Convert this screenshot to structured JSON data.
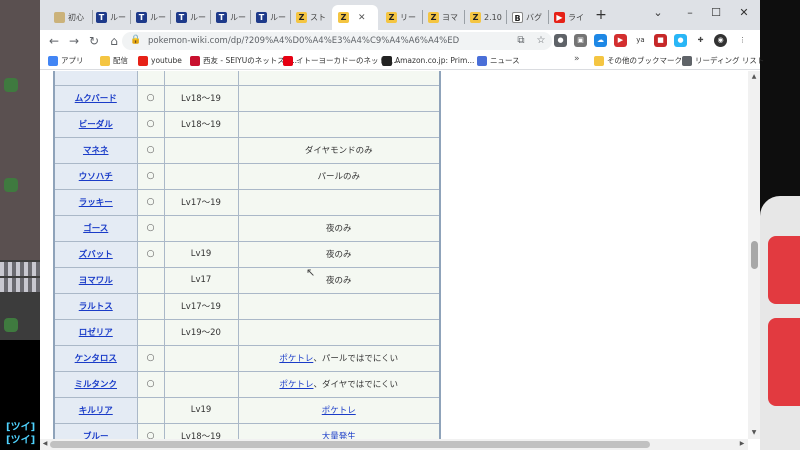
{
  "tabs": [
    {
      "icon": "folder-favicon",
      "title": "初心"
    },
    {
      "icon": "t-favicon",
      "title": "ルー"
    },
    {
      "icon": "t-favicon",
      "title": "ルー"
    },
    {
      "icon": "t-favicon",
      "title": "ルー"
    },
    {
      "icon": "t-favicon",
      "title": "ルー"
    },
    {
      "icon": "t-favicon",
      "title": "ルー"
    },
    {
      "icon": "z-favicon",
      "title": "スト"
    },
    {
      "icon": "z-favicon",
      "title": "",
      "active": true
    },
    {
      "icon": "z-favicon",
      "title": "リー"
    },
    {
      "icon": "z-favicon",
      "title": "ヨマ"
    },
    {
      "icon": "z-favicon",
      "title": "2.10"
    },
    {
      "icon": "b-favicon",
      "title": "バグ"
    },
    {
      "icon": "youtube-favicon",
      "title": "ライ"
    }
  ],
  "toolbar": {
    "url": "pokemon-wiki.com/dp/?209%A4%D0%A4%E3%A4%C9%A4%A6%A4%ED"
  },
  "bookmarks": [
    {
      "label": "アプリ",
      "color": "#4285f4"
    },
    {
      "label": "配信",
      "color": "#f4c542"
    },
    {
      "label": "youtube",
      "color": "#e62117"
    },
    {
      "label": "西友 - SEIYUのネットスー...",
      "color": "#c8102e"
    },
    {
      "label": "イトーヨーカドーのネットス...",
      "color": "#e60012"
    },
    {
      "label": "Amazon.co.jp: Prim...",
      "color": "#222222"
    },
    {
      "label": "ニュース",
      "color": "#4a6fd8"
    }
  ],
  "bookmarks_right": [
    {
      "label": "その他のブックマーク",
      "color": "#f4c542"
    },
    {
      "label": "リーディング リスト",
      "color": "#5f6368"
    }
  ],
  "table": {
    "rows": [
      {
        "name": "ムクバード",
        "mark": "○",
        "lv": "Lv18～19",
        "note": ""
      },
      {
        "name": "ビーダル",
        "mark": "○",
        "lv": "Lv18～19",
        "note": ""
      },
      {
        "name": "マネネ",
        "mark": "○",
        "lv": "",
        "note": "ダイヤモンドのみ"
      },
      {
        "name": "ウソハチ",
        "mark": "○",
        "lv": "",
        "note": "パールのみ"
      },
      {
        "name": "ラッキー",
        "mark": "○",
        "lv": "Lv17～19",
        "note": ""
      },
      {
        "name": "ゴース",
        "mark": "○",
        "lv": "",
        "note": "夜のみ"
      },
      {
        "name": "ズバット",
        "mark": "○",
        "lv": "Lv19",
        "note": "夜のみ"
      },
      {
        "name": "ヨマワル",
        "mark": "",
        "lv": "Lv17",
        "note": "夜のみ"
      },
      {
        "name": "ラルトス",
        "mark": "",
        "lv": "Lv17～19",
        "note": ""
      },
      {
        "name": "ロゼリア",
        "mark": "",
        "lv": "Lv19～20",
        "note": ""
      },
      {
        "name": "ケンタロス",
        "mark": "○",
        "lv": "",
        "note_link": "ポケトレ",
        "note": "、パールではでにくい"
      },
      {
        "name": "ミルタンク",
        "mark": "○",
        "lv": "",
        "note_link": "ポケトレ",
        "note": "、ダイヤではでにくい"
      },
      {
        "name": "キルリア",
        "mark": "",
        "lv": "Lv19",
        "note_link": "ポケトレ",
        "note": ""
      },
      {
        "name": "ブルー",
        "mark": "○",
        "lv": "Lv18～19",
        "note_link": "大量発生",
        "note": ""
      }
    ]
  },
  "overlay": {
    "ticker_1": "[ツイ]",
    "ticker_2": "[ツイ]"
  }
}
